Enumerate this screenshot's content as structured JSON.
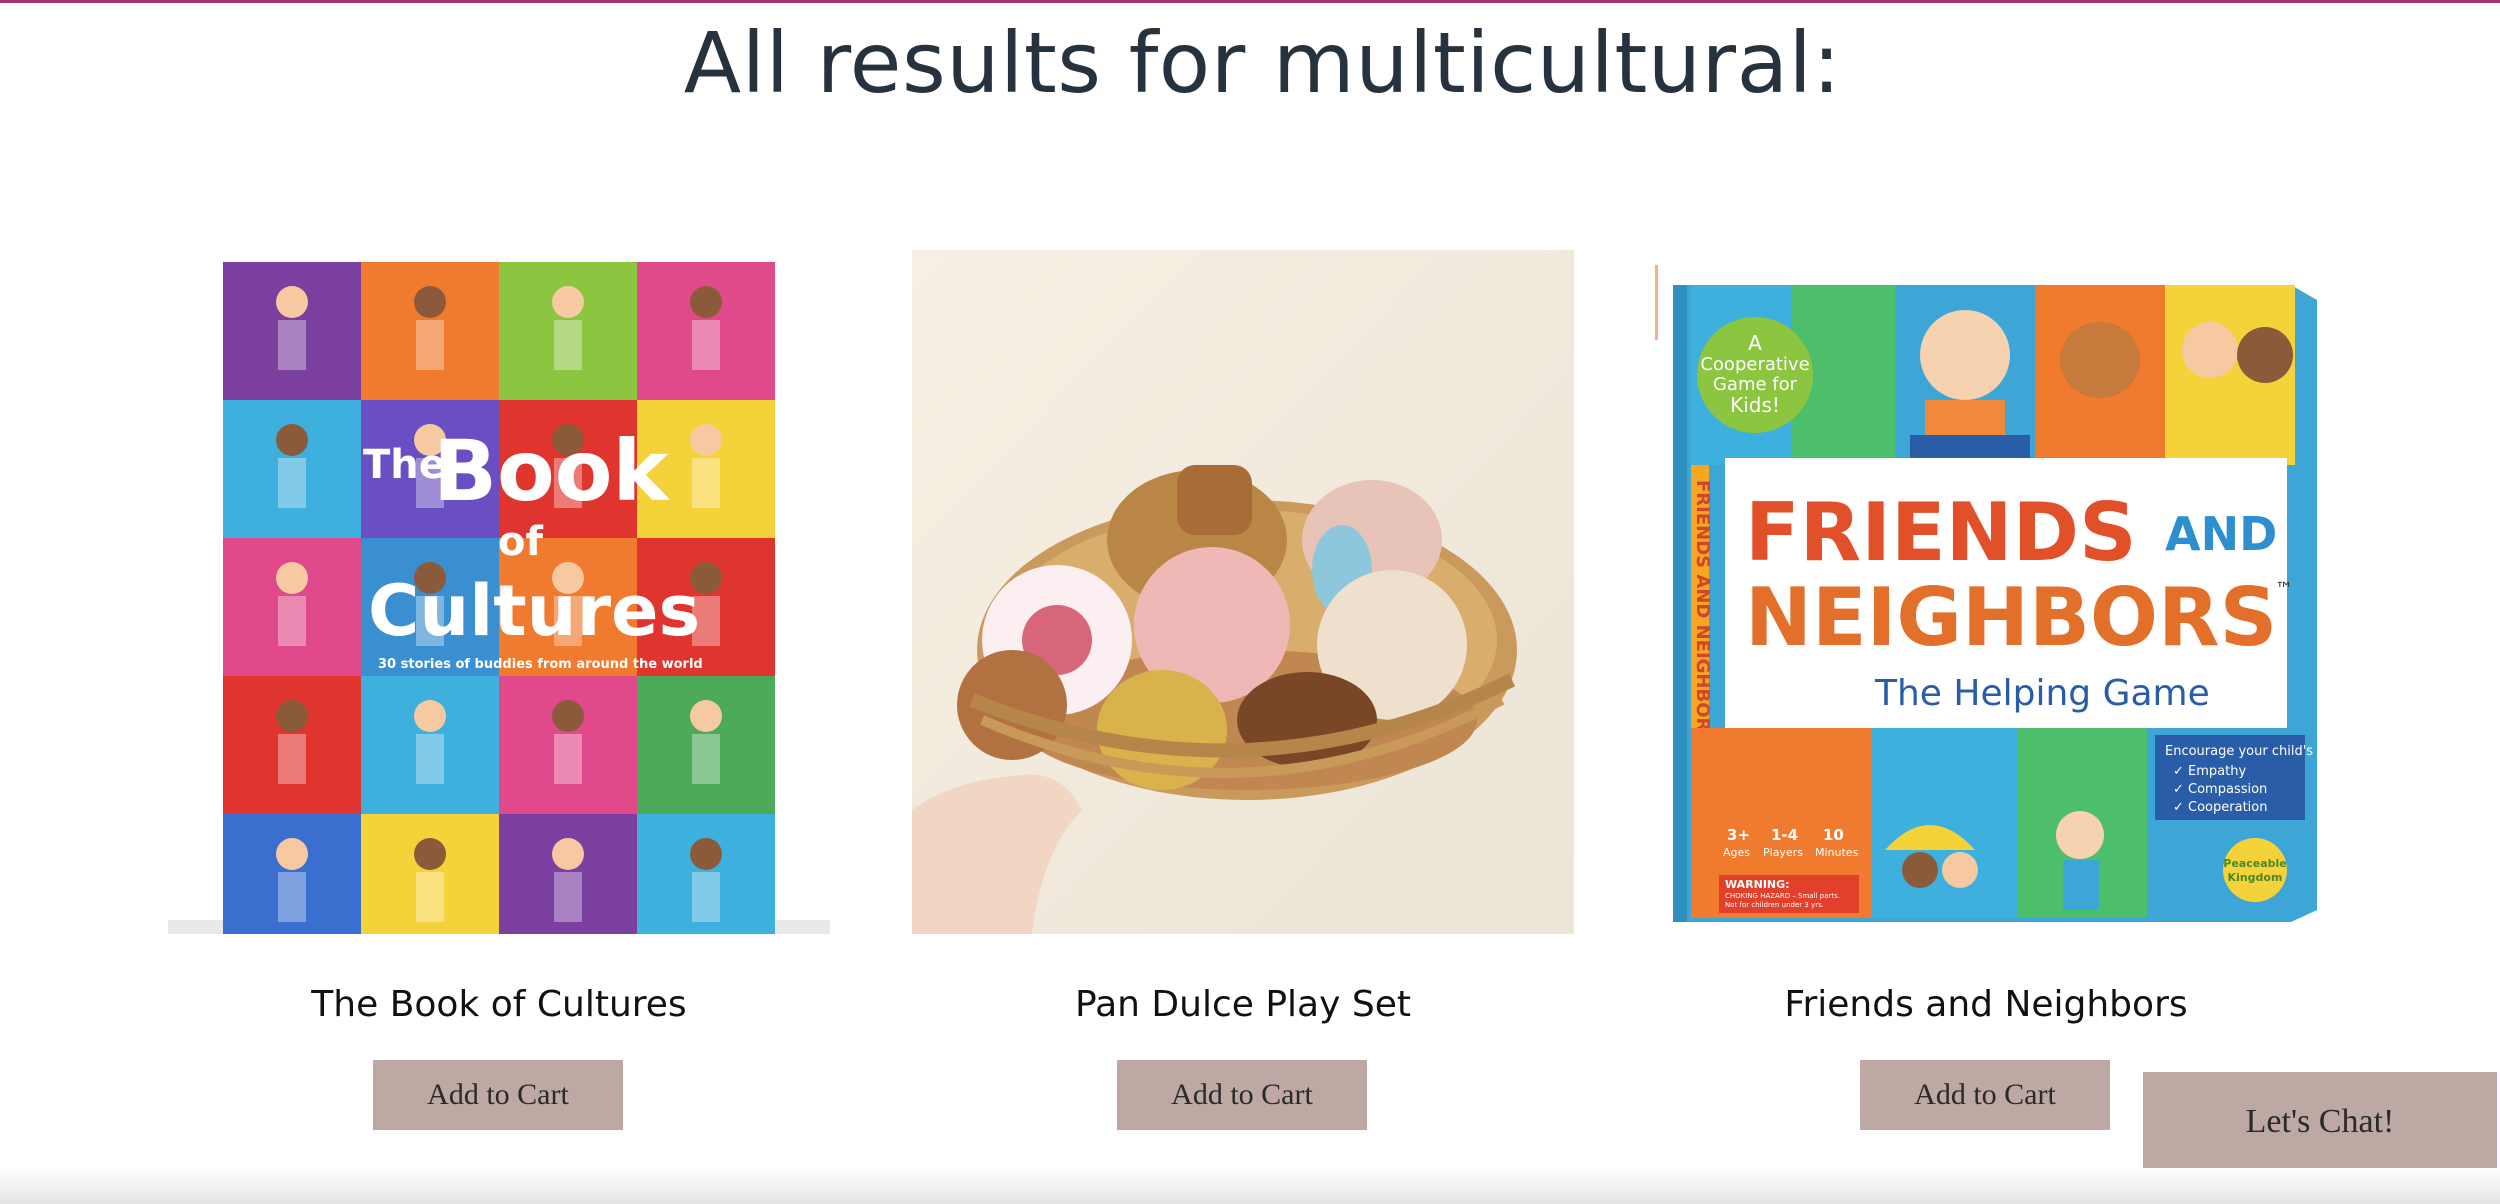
{
  "page": {
    "title": "All results for multicultural:"
  },
  "products": [
    {
      "name": "The Book of Cultures",
      "button": "Add to Cart",
      "cover_text": {
        "line1": "The",
        "line2": "Book",
        "line3": "of",
        "line4": "Cultures",
        "subtitle": "30 stories of buddies from around the world"
      }
    },
    {
      "name": "Pan Dulce Play Set",
      "button": "Add to Cart"
    },
    {
      "name": "Friends and Neighbors",
      "button": "Add to Cart",
      "box_text": {
        "title_a": "FRIENDS",
        "title_b": "AND",
        "title_c": "NEIGHBORS",
        "tm": "™",
        "subtitle": "The Helping Game",
        "badge_1": "A",
        "badge_2": "Cooperative",
        "badge_3": "Game for",
        "badge_4": "Kids!",
        "encourage_1": "Encourage your child's",
        "encourage_2": "✓ Empathy",
        "encourage_3": "✓ Compassion",
        "encourage_4": "✓ Cooperation",
        "ages": "3+",
        "ages_label": "Ages",
        "players": "1-4",
        "players_label": "Players",
        "minutes": "10",
        "minutes_label": "Minutes",
        "warning": "WARNING:",
        "warning_2": "CHOKING HAZARD – Small parts.",
        "warning_3": "Not for children under 3 yrs.",
        "brand_1": "Peaceable",
        "brand_2": "Kingdom",
        "spine": "FRIENDS AND NEIGHBORS"
      }
    }
  ],
  "chat": {
    "label": "Let's Chat!"
  },
  "colors": {
    "accent": "#a0346e",
    "button": "#bea8a3",
    "title": "#27323f"
  }
}
